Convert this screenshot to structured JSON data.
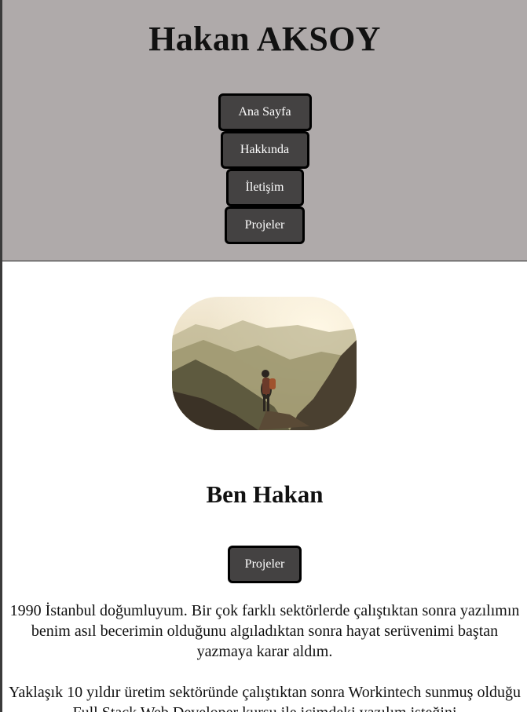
{
  "header": {
    "title": "Hakan AKSOY",
    "nav": [
      {
        "label": "Ana Sayfa"
      },
      {
        "label": "Hakkında"
      },
      {
        "label": "İletişim"
      },
      {
        "label": "Projeler"
      }
    ]
  },
  "hero": {
    "image_alt": "hiker-on-mountain-photo"
  },
  "intro": {
    "title": "Ben Hakan",
    "button_label": "Projeler"
  },
  "bio": {
    "paragraphs": [
      "1990 İstanbul doğumluyum. Bir çok farklı sektörlerde çalıştıktan sonra yazılımın benim asıl becerimin olduğunu algıladıktan sonra hayat serüvenimi baştan yazmaya karar aldım.",
      "Yaklaşık 10 yıldır üretim sektöründe çalıştıktan sonra Workintech sunmuş olduğu Full Stack Web Developer kursu ile içimdeki yazılım isteğini"
    ]
  },
  "colors": {
    "header_bg": "#afaaaa",
    "button_bg": "#444242",
    "button_border": "#000000"
  }
}
